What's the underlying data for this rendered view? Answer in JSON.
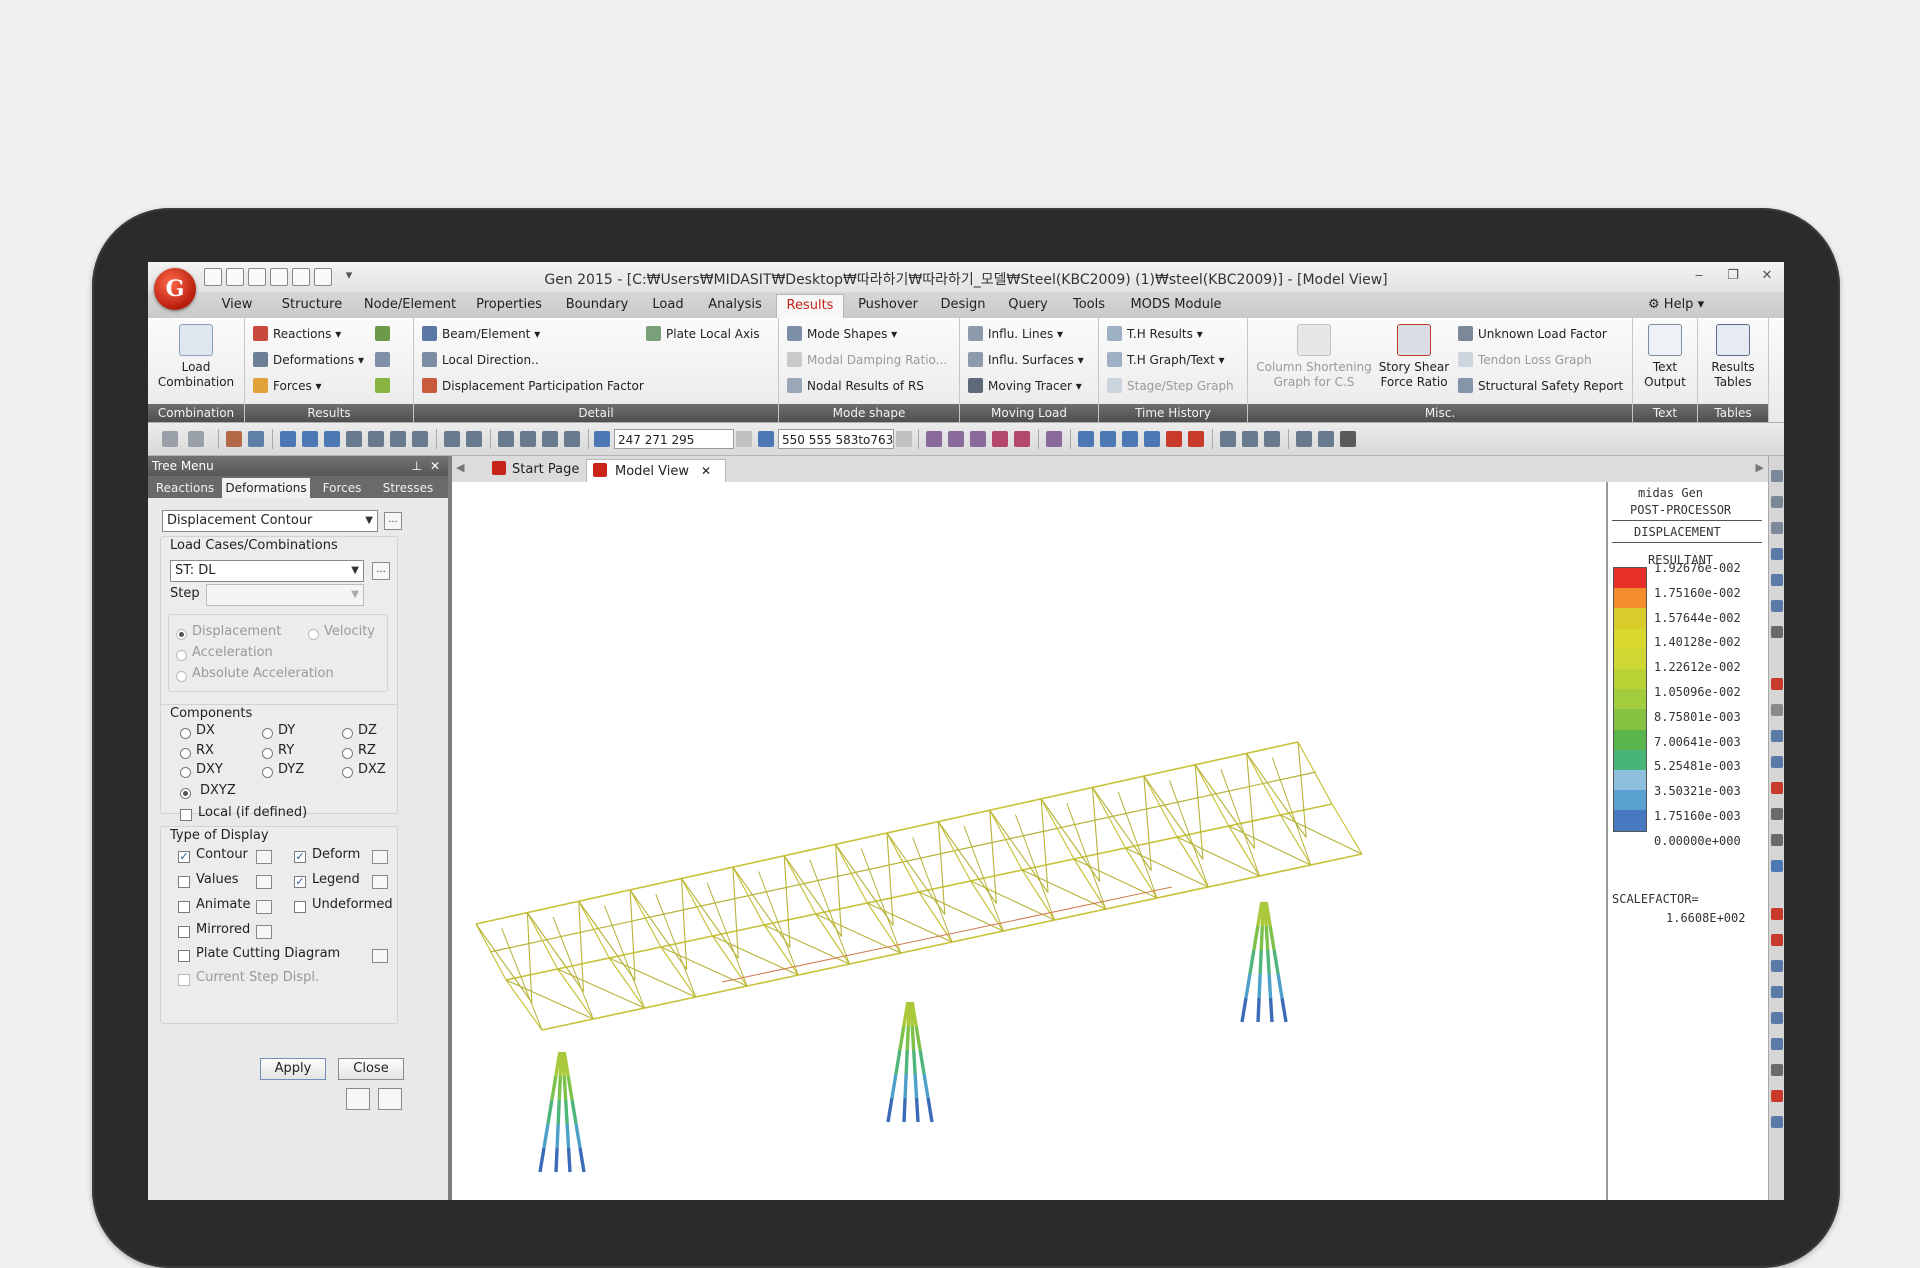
{
  "window": {
    "title": "Gen 2015 - [C:₩Users₩MIDASIT₩Desktop₩따라하기₩따라하기_모델₩Steel(KBC2009) (1)₩steel(KBC2009)] - [Model View]",
    "logo": "G"
  },
  "menu": {
    "tabs": [
      "View",
      "Structure",
      "Node/Element",
      "Properties",
      "Boundary",
      "Load",
      "Analysis",
      "Results",
      "Pushover",
      "Design",
      "Query",
      "Tools",
      "MODS Module"
    ],
    "active": "Results",
    "help": "Help"
  },
  "ribbon": {
    "combination": {
      "big": "Load Combination",
      "label": "Combination"
    },
    "results": {
      "items": [
        "Reactions",
        "Deformations",
        "Forces"
      ],
      "label": "Results"
    },
    "detail": {
      "items": [
        "Beam/Element",
        "Local Direction..",
        "Displacement Participation Factor",
        "Plate Local Axis"
      ],
      "label": "Detail"
    },
    "mode_shape": {
      "items": [
        "Mode Shapes",
        "Modal Damping Ratio...",
        "Nodal Results of RS"
      ],
      "label": "Mode shape"
    },
    "moving_load": {
      "items": [
        "Influ. Lines",
        "Influ. Surfaces",
        "Moving Tracer"
      ],
      "label": "Moving Load"
    },
    "time_history": {
      "items": [
        "T.H Results",
        "T.H Graph/Text",
        "Stage/Step Graph"
      ],
      "label": "Time History"
    },
    "misc": {
      "column_shortening": "Column Shortening Graph for C.S",
      "story_shear": "Story Shear Force Ratio",
      "items": [
        "Unknown Load Factor",
        "Tendon Loss Graph",
        "Structural Safety Report"
      ],
      "label": "Misc."
    },
    "text": {
      "big": "Text Output",
      "label": "Text"
    },
    "tables": {
      "big": "Results Tables",
      "label": "Tables"
    }
  },
  "toolbar": {
    "combo1": "247 271 295",
    "combo2": "550 555 583to763b"
  },
  "tree": {
    "title": "Tree Menu",
    "tabs": [
      "Reactions",
      "Deformations",
      "Forces",
      "Stresses"
    ],
    "active_tab": "Deformations",
    "contour_type": "Displacement Contour",
    "load_cases_label": "Load Cases/Combinations",
    "load_case": "ST: DL",
    "step_label": "Step",
    "motion": [
      "Displacement",
      "Velocity",
      "Acceleration",
      "Absolute Acceleration"
    ],
    "components_label": "Components",
    "components": [
      "DX",
      "DY",
      "DZ",
      "RX",
      "RY",
      "RZ",
      "DXY",
      "DYZ",
      "DXZ",
      "DXYZ"
    ],
    "selected_component": "DXYZ",
    "local_label": "Local (if defined)",
    "display_label": "Type of Display",
    "display": {
      "contour": "Contour",
      "deform": "Deform",
      "values": "Values",
      "legend": "Legend",
      "animate": "Animate",
      "undeformed": "Undeformed",
      "mirrored": "Mirrored",
      "plate_cutting": "Plate Cutting Diagram",
      "current_step": "Current Step Displ."
    },
    "apply": "Apply",
    "close": "Close"
  },
  "doc_tabs": {
    "start": "Start Page",
    "model": "Model View"
  },
  "legend": {
    "line1": "midas Gen",
    "line2": "POST-PROCESSOR",
    "line3": "DISPLACEMENT",
    "line4": "RESULTANT",
    "values": [
      "1.92676e-002",
      "1.75160e-002",
      "1.57644e-002",
      "1.40128e-002",
      "1.22612e-002",
      "1.05096e-002",
      "8.75801e-003",
      "7.00641e-003",
      "5.25481e-003",
      "3.50321e-003",
      "1.75160e-003",
      "0.00000e+000"
    ],
    "colors": [
      "#e8302a",
      "#f28c2c",
      "#d8cc2a",
      "#d8d82e",
      "#cfd832",
      "#b9d236",
      "#a2cc3c",
      "#86c242",
      "#5ab64c",
      "#48b478",
      "#8cc0dc",
      "#5aa0d0",
      "#4878c0"
    ],
    "scale_label": "SCALEFACTOR=",
    "scale_value": "1.6608E+002"
  },
  "colors": {
    "accent_red": "#c8241a",
    "truss": "#c8c23a"
  }
}
